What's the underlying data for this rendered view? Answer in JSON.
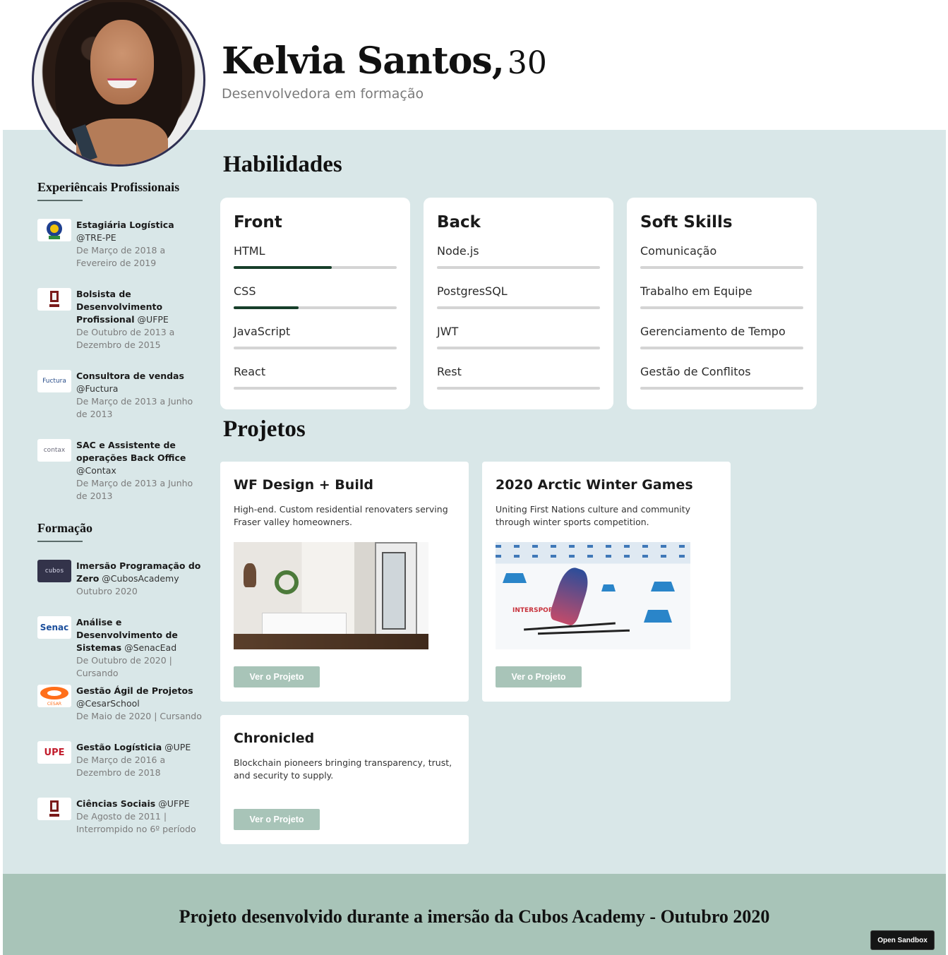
{
  "profile": {
    "name": "Kelvia Santos,",
    "age": "30",
    "subtitle": "Desenvolvedora em formação"
  },
  "sidebar": {
    "experience_title": "Experiêncais Profissionais",
    "experience": [
      {
        "logo": "TRE-PE",
        "title": "Estagiária Logística",
        "org": "@TRE-PE",
        "date": "De Março de 2018 a Fevereiro de 2019"
      },
      {
        "logo": "UFPE",
        "title": "Bolsista de Desenvolvimento Profissional",
        "org": "@UFPE",
        "date": "De Outubro de 2013 a Dezembro de 2015"
      },
      {
        "logo": "Fuctura",
        "title": "Consultora de vendas",
        "org": "@Fuctura",
        "date": "De Março de 2013 a Junho de 2013"
      },
      {
        "logo": "contax",
        "title": "SAC e Assistente de operações Back Office",
        "org": "@Contax",
        "date": "De Março de 2013 a Junho de 2013"
      }
    ],
    "education_title": "Formação",
    "education": [
      {
        "logo": "cubos",
        "title": "Imersão Programação do Zero",
        "org": "@CubosAcademy",
        "date": "Outubro 2020"
      },
      {
        "logo": "Senac",
        "title": "Análise e Desenvolvimento de Sistemas",
        "org": "@SenacEad",
        "date": "De Outubro de 2020 | Cursando"
      },
      {
        "logo": "CESAR",
        "title": "Gestão Ágil de Projetos",
        "org": "@CesarSchool",
        "date": "De Maio de 2020 | Cursando"
      },
      {
        "logo": "UPE",
        "title": "Gestão Logísticia",
        "org": "@UPE",
        "date": "De Março de 2016 a Dezembro de 2018"
      },
      {
        "logo": "UFPE",
        "title": "Ciências Sociais",
        "org": "@UFPE",
        "date": "De Agosto de 2011 | Interrompido no 6º período"
      }
    ]
  },
  "skills": {
    "title": "Habilidades",
    "cards": [
      {
        "title": "Front",
        "items": [
          {
            "label": "HTML",
            "level": 0.6
          },
          {
            "label": "CSS",
            "level": 0.4
          },
          {
            "label": "JavaScript",
            "level": 0
          },
          {
            "label": "React",
            "level": 0
          }
        ]
      },
      {
        "title": "Back",
        "items": [
          {
            "label": "Node.js",
            "level": 0
          },
          {
            "label": "PostgresSQL",
            "level": 0
          },
          {
            "label": "JWT",
            "level": 0
          },
          {
            "label": "Rest",
            "level": 0
          }
        ]
      },
      {
        "title": "Soft Skills",
        "items": [
          {
            "label": "Comunicação",
            "level": 0
          },
          {
            "label": "Trabalho em Equipe",
            "level": 0
          },
          {
            "label": "Gerenciamento de Tempo",
            "level": 0
          },
          {
            "label": "Gestão de Conflitos",
            "level": 0
          }
        ]
      }
    ]
  },
  "projects": {
    "title": "Projetos",
    "items": [
      {
        "title": "WF Design + Build",
        "desc": "High-end. Custom residential renovaters serving Fraser valley homeowners.",
        "button": "Ver o Projeto"
      },
      {
        "title": "2020 Arctic Winter Games",
        "desc": "Uniting First Nations culture and community through winter sports competition.",
        "button": "Ver o Projeto",
        "image_text": "INTERSPORT"
      },
      {
        "title": "Chronicled",
        "desc": "Blockchain pioneers bringing transparency, trust, and security to supply.",
        "button": "Ver o Projeto"
      }
    ]
  },
  "footer": {
    "text": "Projeto desenvolvido durante a imersão da Cubos Academy - Outubro 2020",
    "sandbox_button": "Open Sandbox"
  },
  "colors": {
    "main_bg": "#d9e7e8",
    "footer_bg": "#a8c4b8",
    "skill_fill": "#173f2a",
    "button_bg": "#a8c4b8"
  }
}
